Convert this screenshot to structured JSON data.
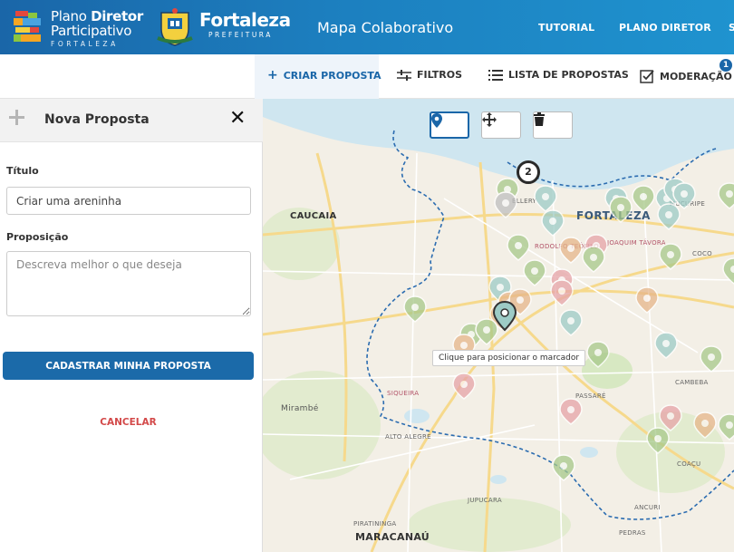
{
  "header": {
    "logo_line1_regular": "Plano ",
    "logo_line1_bold": "Diretor",
    "logo_line2": "Participativo",
    "logo_line3": "FORTALEZA",
    "city_name": "Fortaleza",
    "city_sub": "PREFEITURA",
    "app_title": "Mapa Colaborativo",
    "nav": [
      "TUTORIAL",
      "PLANO DIRETOR",
      "S"
    ]
  },
  "toolbar": {
    "create": "CRIAR PROPOSTA",
    "filters": "FILTROS",
    "list": "LISTA DE PROPOSTAS",
    "moderation": "MODERAÇÃO",
    "moderation_badge": "1"
  },
  "panel": {
    "title": "Nova Proposta",
    "title_label": "Título",
    "title_value": "Criar uma areninha",
    "proposition_label": "Proposição",
    "proposition_placeholder": "Descreva melhor o que deseja",
    "submit": "CADASTRAR MINHA PROPOSTA",
    "cancel": "CANCELAR"
  },
  "map": {
    "tooltip": "Clique para posicionar o marcador",
    "cluster_count": "2",
    "tools": [
      "marker-icon",
      "move-icon",
      "trash-icon"
    ],
    "labels": {
      "caucaia": "CAUCAIA",
      "fortaleza": "FORTALEZA",
      "maracanau": "MARACANAÚ",
      "mirambe": "Mirambé",
      "ellery": "ELLERY",
      "rodolfo_teofilo": "RODOLFO TEÓFILO",
      "joaquim_tavora": "JOAQUIM TÁVORA",
      "mucuripe": "MUCURIPE",
      "coco": "COCO",
      "siqueira": "SIQUEIRA",
      "passare": "PASSARÉ",
      "cambeba": "CAMBEBA",
      "alto_alegre": "ALTO ALEGRE",
      "coacu": "COAÇU",
      "jupucara": "JUPUCARA",
      "ancuri": "ANCURI",
      "pedras": "PEDRAS",
      "piratininga": "PIRATININGA"
    }
  },
  "colors": {
    "primary": "#1a66a8",
    "cancel": "#d34949",
    "pin_green": "#a8c98a",
    "pin_teal": "#9dcbc6",
    "pin_pink": "#e6a3a8",
    "pin_orange": "#e6b68a",
    "ocean": "#cfe6f0"
  }
}
